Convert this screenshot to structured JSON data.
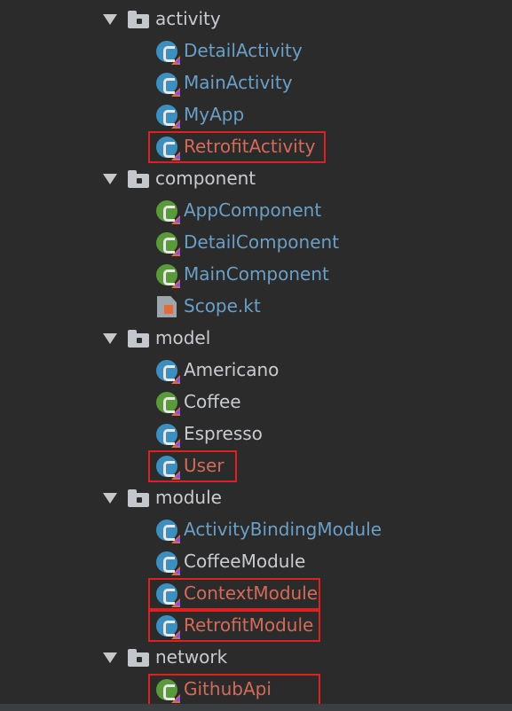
{
  "tree": {
    "packages": [
      {
        "name": "activity",
        "files": [
          {
            "name": "DetailActivity",
            "icon": "kotlin-class-icon",
            "color": "blue",
            "highlighted": false
          },
          {
            "name": "MainActivity",
            "icon": "kotlin-class-icon",
            "color": "blue",
            "highlighted": false
          },
          {
            "name": "MyApp",
            "icon": "kotlin-class-icon",
            "color": "blue",
            "highlighted": false
          },
          {
            "name": "RetrofitActivity",
            "icon": "kotlin-class-icon",
            "color": "red",
            "highlighted": true
          }
        ]
      },
      {
        "name": "component",
        "files": [
          {
            "name": "AppComponent",
            "icon": "kotlin-interface-icon",
            "color": "blue",
            "highlighted": false
          },
          {
            "name": "DetailComponent",
            "icon": "kotlin-interface-icon",
            "color": "blue",
            "highlighted": false
          },
          {
            "name": "MainComponent",
            "icon": "kotlin-interface-icon",
            "color": "blue",
            "highlighted": false
          },
          {
            "name": "Scope.kt",
            "icon": "kotlin-file-icon",
            "color": "blue",
            "highlighted": false
          }
        ]
      },
      {
        "name": "model",
        "files": [
          {
            "name": "Americano",
            "icon": "kotlin-class-icon",
            "color": "plain",
            "highlighted": false
          },
          {
            "name": "Coffee",
            "icon": "kotlin-interface-icon",
            "color": "plain",
            "highlighted": false
          },
          {
            "name": "Espresso",
            "icon": "kotlin-class-icon",
            "color": "plain",
            "highlighted": false
          },
          {
            "name": "User",
            "icon": "kotlin-class-icon",
            "color": "red",
            "highlighted": true
          }
        ]
      },
      {
        "name": "module",
        "files": [
          {
            "name": "ActivityBindingModule",
            "icon": "kotlin-abstract-class-icon",
            "color": "blue",
            "highlighted": false
          },
          {
            "name": "CoffeeModule",
            "icon": "kotlin-abstract-class-icon",
            "color": "plain",
            "highlighted": false
          },
          {
            "name": "ContextModule",
            "icon": "kotlin-abstract-class-icon",
            "color": "red",
            "highlighted": true
          },
          {
            "name": "RetrofitModule",
            "icon": "kotlin-class-icon",
            "color": "red",
            "highlighted": true
          }
        ]
      },
      {
        "name": "network",
        "files": [
          {
            "name": "GithubApi",
            "icon": "kotlin-interface-icon",
            "color": "red",
            "highlighted": true
          }
        ]
      }
    ]
  },
  "colors": {
    "background": "#2b2b2b",
    "text_blue": "#6a9fc8",
    "text_plain": "#c8cbcf",
    "text_red": "#d46a5a",
    "highlight_border": "#e02020"
  }
}
